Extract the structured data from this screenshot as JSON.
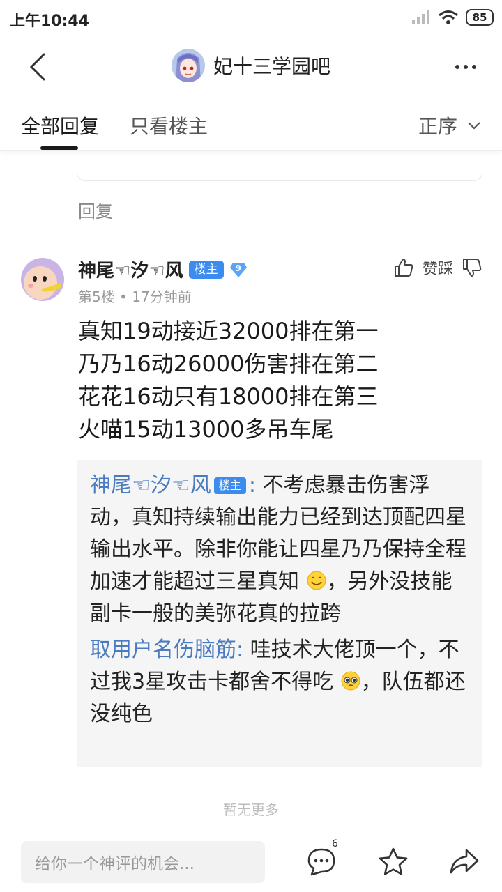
{
  "status_bar": {
    "time": "上午10:44",
    "battery": "85"
  },
  "nav": {
    "title": "妃十三学园吧"
  },
  "tabs": {
    "all": "全部回复",
    "owner_only": "只看楼主",
    "sort": "正序"
  },
  "reply_link": "回复",
  "post": {
    "username": "神尾☜汐☜风",
    "owner_badge": "楼主",
    "level": "9",
    "meta": "第5楼 • 17分钟前",
    "vote_label": "赞踩",
    "body_lines": [
      "真知19动接近32000排在第一",
      "乃乃16动26000伤害排在第二",
      "花花16动只有18000排在第三",
      "火喵15动13000多吊车尾"
    ],
    "sub_replies": [
      {
        "name": "神尾☜汐☜风",
        "badge": "楼主",
        "text_a": "不考虑暴击伤害浮动，真知持续输出能力已经到达顶配四星输出水平。除非你能让四星乃乃保持全程加速才能超过三星真知",
        "emoji_a": "smile-emoji",
        "text_b": "，另外没技能副卡一般的美弥花真的拉跨"
      },
      {
        "name": "取用户名伤脑筋",
        "text_a": "哇技术大佬顶一个，不过我3星攻击卡都舍不得吃",
        "emoji_a": "pleading-emoji",
        "text_b": "，队伍都还没纯色"
      }
    ]
  },
  "no_more": "暂无更多",
  "bottom_bar": {
    "input_placeholder": "给你一个神评的机会...",
    "comment_count": "6"
  },
  "colors": {
    "accent_blue": "#3c8cf0",
    "sub_name_blue": "#4a7bc0",
    "sub_bg": "#f5f5f5"
  }
}
